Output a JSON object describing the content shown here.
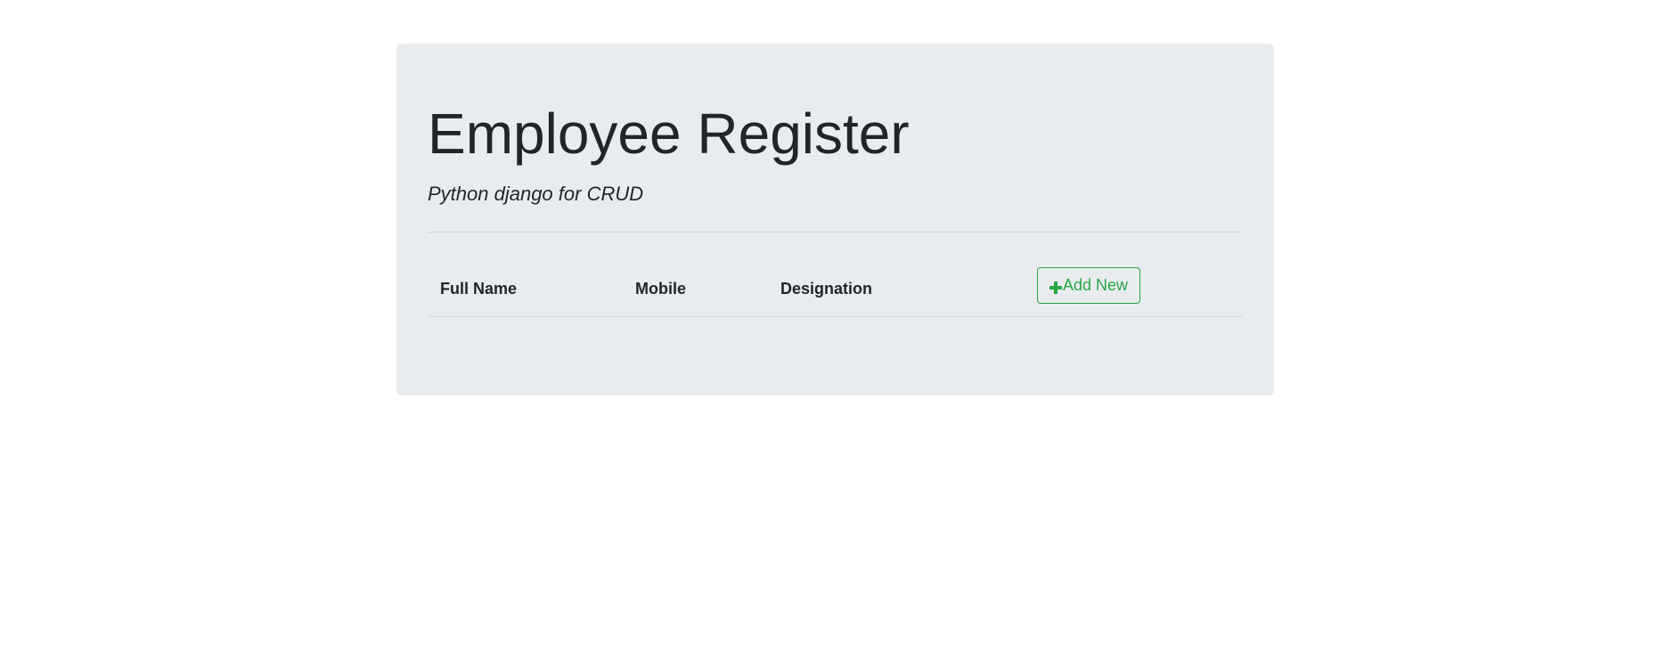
{
  "header": {
    "title": "Employee Register",
    "subtitle": "Python django for CRUD"
  },
  "table": {
    "columns": [
      "Full Name",
      "Mobile",
      "Designation"
    ],
    "add_button": {
      "label": "Add New",
      "icon": "plus-icon"
    },
    "rows": []
  },
  "colors": {
    "jumbotron_bg": "#e9ecef",
    "accent_green": "#28a745",
    "text": "#212529"
  }
}
